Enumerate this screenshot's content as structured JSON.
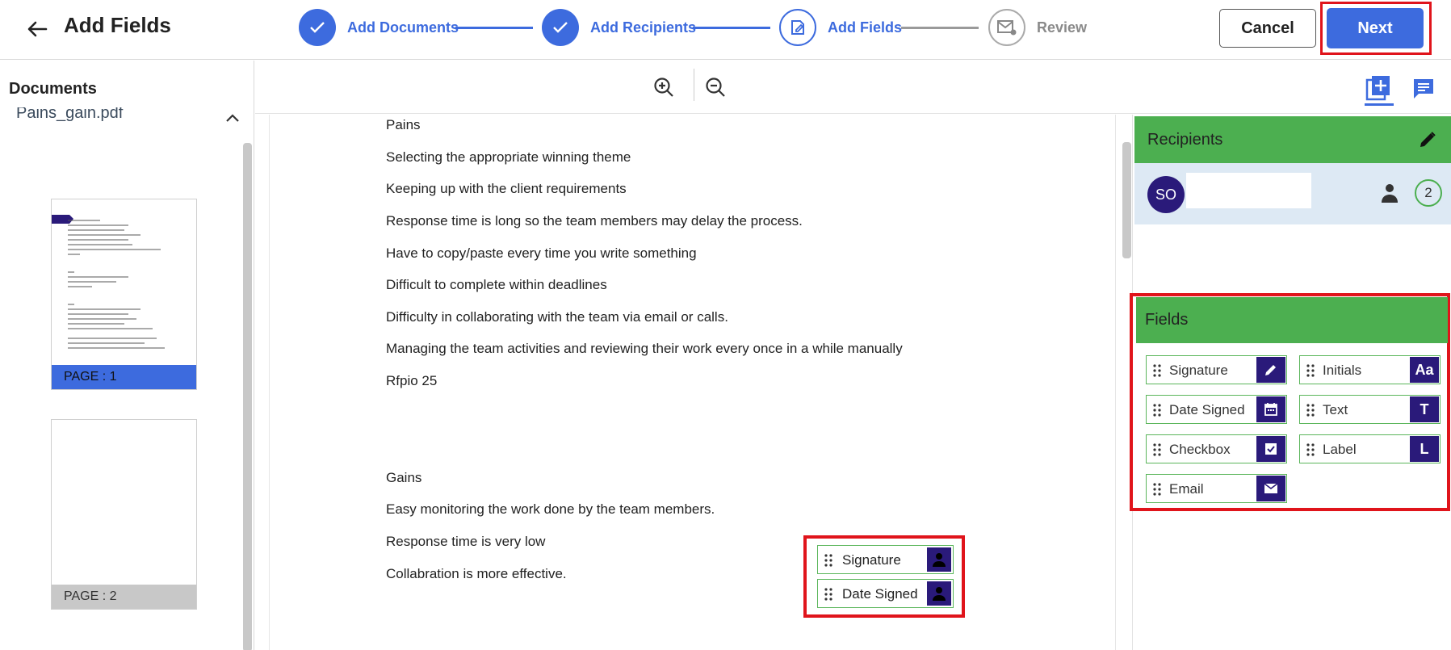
{
  "header": {
    "title": "Add Fields",
    "steps": [
      {
        "label": "Add Documents",
        "state": "done"
      },
      {
        "label": "Add Recipients",
        "state": "done"
      },
      {
        "label": "Add Fields",
        "state": "current"
      },
      {
        "label": "Review",
        "state": "todo"
      }
    ],
    "cancel_label": "Cancel",
    "next_label": "Next"
  },
  "documents_panel": {
    "title": "Documents",
    "file_name": "Pains_gain.pdf",
    "pages": [
      {
        "label": "PAGE : 1",
        "selected": true
      },
      {
        "label": "PAGE : 2",
        "selected": false
      }
    ]
  },
  "document": {
    "lines": [
      "Pains",
      "Selecting the appropriate winning theme",
      "Keeping up with the client requirements",
      "Response time is long so the team members may delay the process.",
      "Have to copy/paste every time you write something",
      "Difficult to complete within deadlines",
      "Difficulty in collaborating with the team via email or calls.",
      "Managing the team activities and reviewing their work every once in a while manually",
      "Rfpio 25",
      "Gains",
      "Easy monitoring the work done by the team members.",
      "Response time is very low",
      "Collabration is more effective."
    ],
    "placed_fields": [
      {
        "label": "Signature",
        "icon": "person-icon"
      },
      {
        "label": "Date Signed",
        "icon": "person-icon"
      }
    ]
  },
  "recipients": {
    "title": "Recipients",
    "recipient": {
      "initials": "SO",
      "count": "2"
    }
  },
  "fields_panel": {
    "title": "Fields",
    "items": [
      {
        "label": "Signature",
        "icon": "pen-icon",
        "glyph": ""
      },
      {
        "label": "Initials",
        "icon": "initials-icon",
        "glyph": "Aa"
      },
      {
        "label": "Date Signed",
        "icon": "calendar-icon",
        "glyph": ""
      },
      {
        "label": "Text",
        "icon": "text-icon",
        "glyph": "T"
      },
      {
        "label": "Checkbox",
        "icon": "checkbox-icon",
        "glyph": ""
      },
      {
        "label": "Label",
        "icon": "label-icon",
        "glyph": "L"
      },
      {
        "label": "Email",
        "icon": "mail-icon",
        "glyph": ""
      }
    ]
  },
  "colors": {
    "accent": "#3d6bde",
    "green_header": "#4caf50",
    "field_icon_bg": "#2a1a7a",
    "highlight": "#e0141b"
  }
}
